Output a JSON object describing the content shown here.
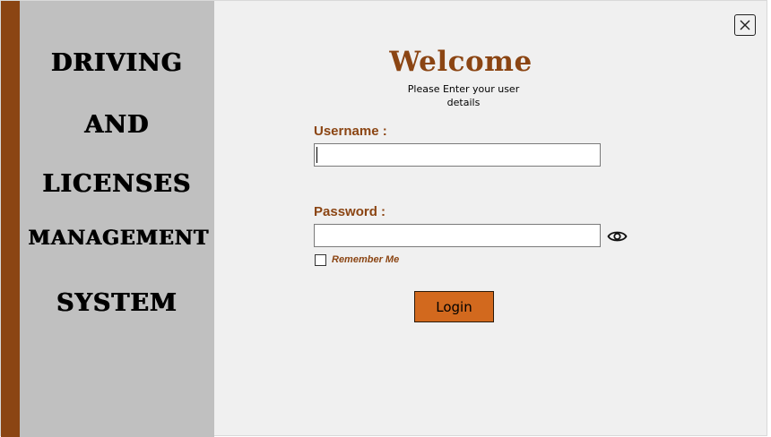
{
  "side_panel": {
    "words": [
      "DRIVING",
      "AND",
      "LICENSES",
      "MANAGEMENT",
      "SYSTEM"
    ]
  },
  "header": {
    "title": "Welcome",
    "subtitle_line1": "Please Enter your user",
    "subtitle_line2": "details"
  },
  "form": {
    "username_label": "Username :",
    "username_value": "",
    "password_label": "Password :",
    "password_value": "",
    "remember_label": "Remember Me",
    "remember_checked": false,
    "login_label": "Login"
  },
  "icons": {
    "close": "close-icon",
    "show_password": "eye-icon"
  },
  "colors": {
    "brand_brown": "#8b4513",
    "login_orange": "#d2691e",
    "side_gray": "#c0c0c0",
    "background": "#f0f0f0"
  }
}
